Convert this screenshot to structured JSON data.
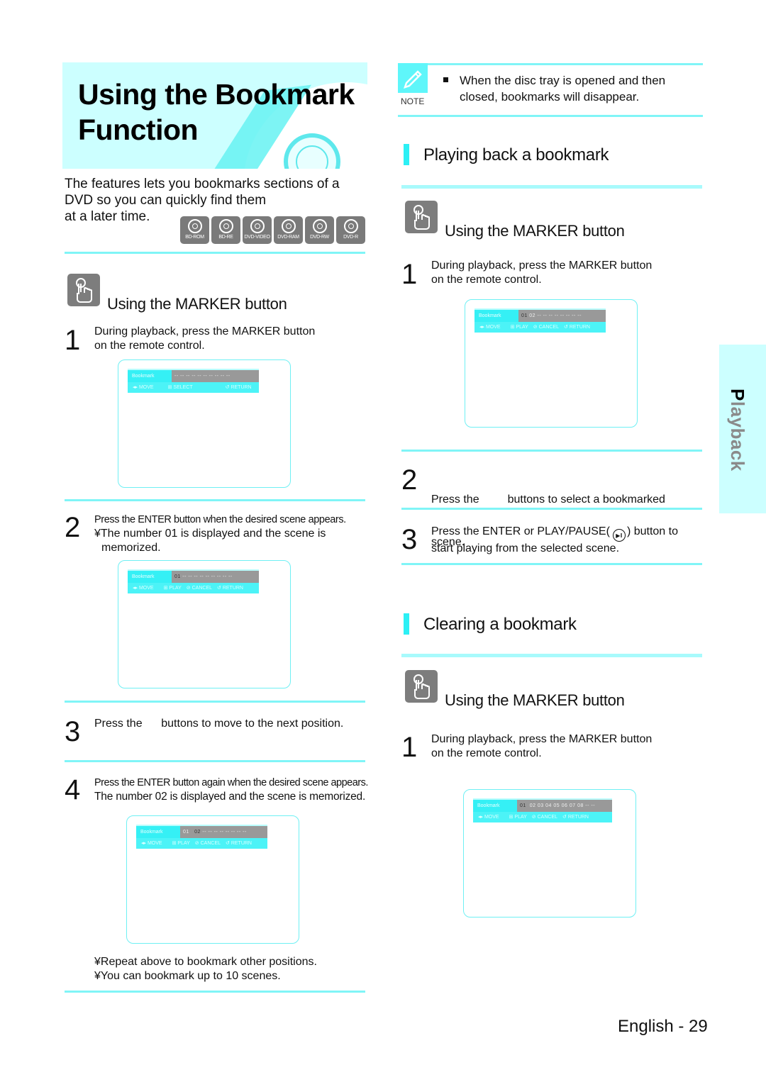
{
  "page": {
    "title_line1": "Using the Bookmark",
    "title_line2": "Function",
    "intro": "The features lets you bookmarks sections of a DVD so you can quickly find them",
    "intro_line3": "at a later time.",
    "disc_badges": [
      "BD-ROM",
      "BD-RE",
      "DVD-VIDEO",
      "DVD-RAM",
      "DVD-RW",
      "DVD-R"
    ],
    "side_tab": "Playback",
    "footer": "English - 29",
    "accent_color": "#2cf0f5"
  },
  "left": {
    "subhead": "Using the MARKER button",
    "step1": {
      "num": "1",
      "line1": "During playback, press the MARKER  button",
      "line2": "on the remote control."
    },
    "step2": {
      "num": "2",
      "line1": "Press the ENTER button when the desired scene appears.",
      "line2": "¥The number 01 is displayed and the scene is",
      "line3": "memorized."
    },
    "step3": {
      "num": "3",
      "text": "Press the      buttons to move to the next position."
    },
    "step4": {
      "num": "4",
      "line1": "Press the ENTER button again when the desired scene appears.",
      "line2": "The number 02 is displayed and the scene is memorized."
    },
    "tips": [
      "¥Repeat above to bookmark other positions.",
      "¥You can bookmark up to 10 scenes."
    ]
  },
  "osd": {
    "label": "Bookmark",
    "screen1": {
      "nums": "-- -- -- -- -- -- -- -- -- --",
      "actions": [
        "◂▸ MOVE",
        "⊞ SELECT",
        "↺ RETURN"
      ]
    },
    "screen2": {
      "sel": "01",
      "nums": "-- -- -- -- -- -- -- -- --",
      "actions": [
        "◂▸ MOVE",
        "⊞ PLAY",
        "⊘ CANCEL",
        "↺ RETURN"
      ]
    },
    "screen3": {
      "a": "01",
      "sel": "02",
      "nums": "-- -- -- -- -- -- -- --",
      "actions": [
        "◂▸ MOVE",
        "⊞ PLAY",
        "⊘ CANCEL",
        "↺ RETURN"
      ]
    },
    "screen4": {
      "a": "01",
      "sel": "02",
      "nums": "-- -- -- -- -- -- -- --",
      "actions": [
        "◂▸ MOVE",
        "⊞ PLAY",
        "⊘ CANCEL",
        "↺ RETURN"
      ]
    },
    "screen5": {
      "sel": "01",
      "nums": "02  03  04  05  06  07  08 -- --",
      "actions": [
        "◂▸ MOVE",
        "⊞ PLAY",
        "⊘ CANCEL",
        "↺ RETURN"
      ]
    }
  },
  "right": {
    "note_label": "NOTE",
    "note_line1": "When the disc tray is opened and then",
    "note_line2": "closed, bookmarks will disappear.",
    "playback_title": "Playing back a bookmark",
    "playback_subhead": "Using the MARKER button",
    "pb_step1": {
      "num": "1",
      "line1": "During playback, press the MARKER  button",
      "line2": "on the remote control."
    },
    "pb_step2": {
      "num": "2",
      "line1": "Press the         buttons to select a bookmarked",
      "line2": "scene."
    },
    "pb_step3": {
      "num": "3",
      "line1a": "Press the ENTER or PLAY/PAUSE(",
      "line1b": ") button to",
      "line2": "start playing from the selected scene."
    },
    "clear_title": "Clearing a bookmark",
    "clear_subhead": "Using the MARKER button",
    "cl_step1": {
      "num": "1",
      "line1": "During playback, press the MARKER  button",
      "line2": "on the remote control."
    }
  }
}
